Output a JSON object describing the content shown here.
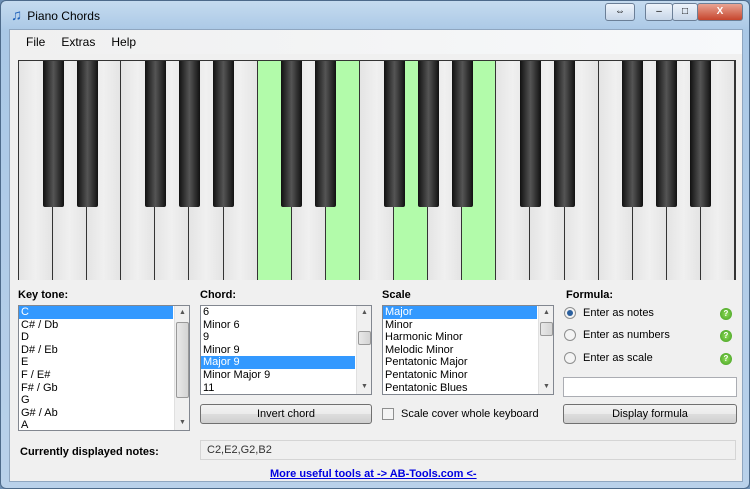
{
  "window": {
    "title": "Piano Chords",
    "buttons": {
      "restore_icon": "arrows-icon",
      "minimize": "–",
      "maximize": "□",
      "close": "X"
    }
  },
  "menu": [
    "File",
    "Extras",
    "Help"
  ],
  "keyboard": {
    "white_keys": [
      "C1",
      "D1",
      "E1",
      "F1",
      "G1",
      "A1",
      "B1",
      "C2",
      "D2",
      "E2",
      "F2",
      "G2",
      "A2",
      "B2",
      "C3",
      "D3",
      "E3",
      "F3",
      "G3",
      "A3",
      "B3"
    ],
    "black_keys_after_white_index": [
      0,
      1,
      3,
      4,
      5,
      7,
      8,
      10,
      11,
      12,
      14,
      15,
      17,
      18,
      19
    ],
    "highlighted": [
      "C2",
      "E2",
      "G2",
      "B2"
    ],
    "highlight_color": "#b2fbaa"
  },
  "key_tone": {
    "label": "Key tone:",
    "items": [
      "C",
      "C# / Db",
      "D",
      "D# / Eb",
      "E",
      "F / E#",
      "F# / Gb",
      "G",
      "G# / Ab",
      "A"
    ],
    "selected": 0
  },
  "chord": {
    "label": "Chord:",
    "items": [
      "6",
      "Minor 6",
      "9",
      "Minor 9",
      "Major 9",
      "Minor Major 9",
      "11"
    ],
    "selected": 4,
    "invert_label": "Invert chord"
  },
  "scale": {
    "label": "Scale",
    "items": [
      "Major",
      "Minor",
      "Harmonic Minor",
      "Melodic Minor",
      "Pentatonic Major",
      "Pentatonic Minor",
      "Pentatonic Blues"
    ],
    "selected": 0,
    "cover_label": "Scale cover whole keyboard",
    "cover_checked": false
  },
  "formula": {
    "label": "Formula:",
    "options": [
      "Enter as notes",
      "Enter as numbers",
      "Enter as scale"
    ],
    "selected": 0,
    "input_value": "",
    "display_label": "Display formula"
  },
  "current": {
    "label": "Currently displayed notes:",
    "value": "C2,E2,G2,B2"
  },
  "footer_link": "More useful tools at -> AB-Tools.com <-"
}
